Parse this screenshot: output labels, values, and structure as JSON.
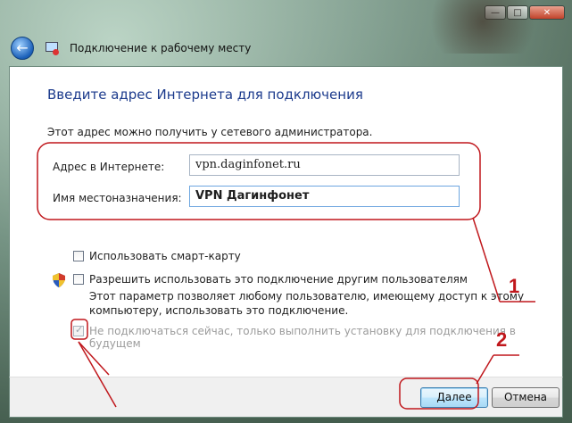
{
  "window": {
    "title": "Подключение к рабочему месту",
    "buttons": {
      "minimize": "—",
      "maximize": "□",
      "close": "✕"
    }
  },
  "page": {
    "heading": "Введите адрес Интернета для подключения",
    "hint": "Этот адрес можно получить у сетевого администратора."
  },
  "form": {
    "address_label": "Адрес в Интернете:",
    "address_value": "vpn.daginfonet.ru",
    "dest_label": "Имя местоназначения:",
    "dest_value": "VPN Дагинфонет"
  },
  "options": {
    "smartcard_label": "Использовать смарт-карту",
    "smartcard_checked": false,
    "share_label": "Разрешить использовать это подключение другим пользователям",
    "share_checked": false,
    "share_desc_1": "Этот параметр позволяет любому пользователю, имеющему доступ к этому",
    "share_desc_2": "компьютеру, использовать это подключение.",
    "later_label": "Не подключаться сейчас, только выполнить установку для подключения в будущем",
    "later_checked": true
  },
  "footer": {
    "next_label": "Далее",
    "cancel_label": "Отмена"
  },
  "annotations": {
    "marker_1": "1",
    "marker_2": "2",
    "color": "#c0171c"
  },
  "icons": [
    "back-arrow-icon",
    "network-connection-icon",
    "uac-shield-icon",
    "checkmark-icon"
  ]
}
